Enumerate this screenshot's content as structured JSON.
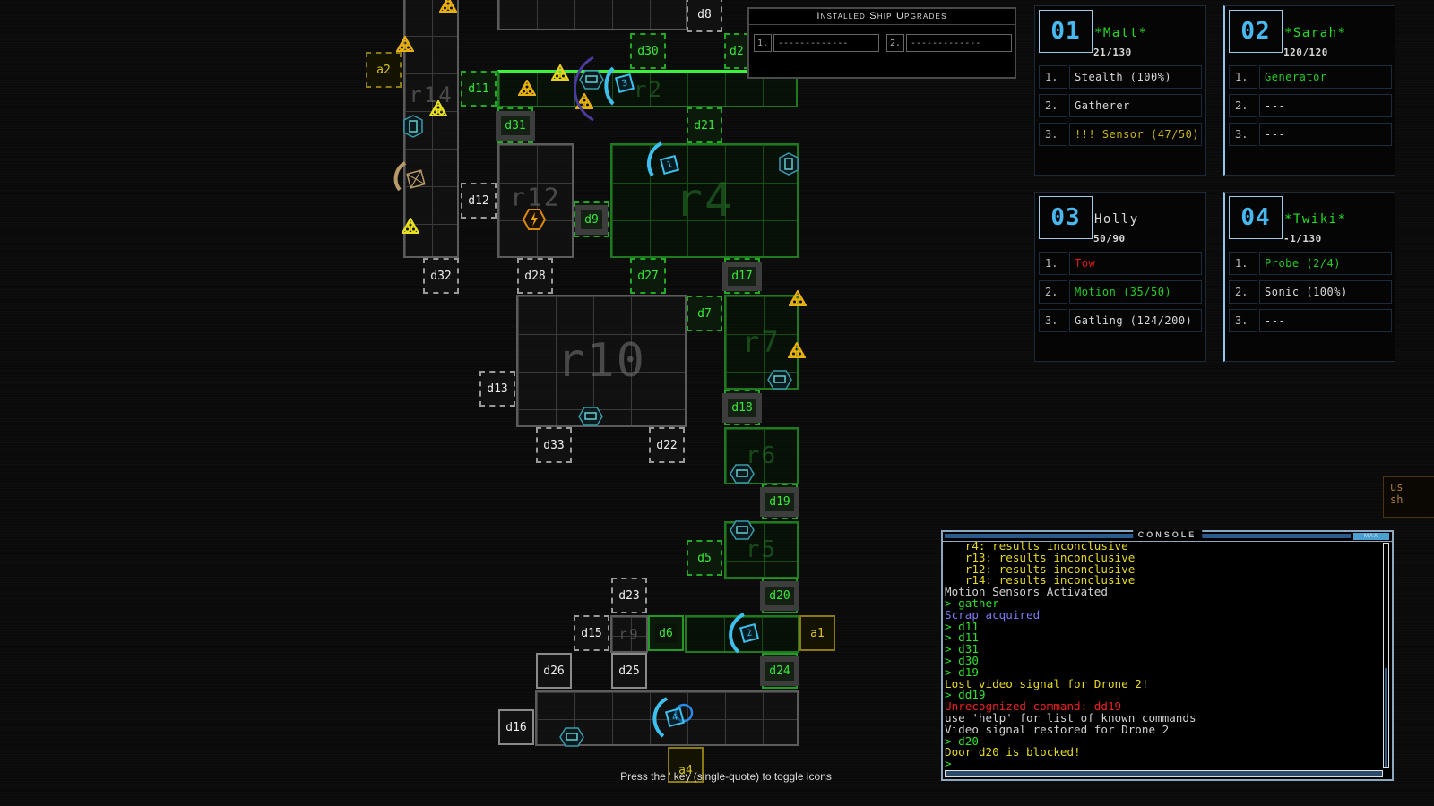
{
  "upgrades": {
    "title": "Installed Ship Upgrades",
    "slots": [
      {
        "num": "1.",
        "value": "-------------"
      },
      {
        "num": "2.",
        "value": "-------------"
      }
    ]
  },
  "drones": [
    {
      "id": "01",
      "name": "*Matt*",
      "name_color": "#22dd22",
      "hp": "21/130",
      "items": [
        {
          "num": "1.",
          "label": "Stealth (100%)",
          "color": "#d8d8d8"
        },
        {
          "num": "2.",
          "label": "Gatherer",
          "color": "#d8d8d8"
        },
        {
          "num": "3.",
          "label": "!!! Sensor (47/50)",
          "color": "#c8b412"
        }
      ]
    },
    {
      "id": "02",
      "name": "*Sarah*",
      "name_color": "#22dd22",
      "hp": "120/120",
      "items": [
        {
          "num": "1.",
          "label": "Generator",
          "color": "#22cc22"
        },
        {
          "num": "2.",
          "label": "---",
          "color": "#d8d8d8"
        },
        {
          "num": "3.",
          "label": "---",
          "color": "#d8d8d8"
        }
      ]
    },
    {
      "id": "03",
      "name": "Holly",
      "name_color": "#d8d8d8",
      "hp": "50/90",
      "items": [
        {
          "num": "1.",
          "label": "Tow",
          "color": "#dd1a1a"
        },
        {
          "num": "2.",
          "label": "Motion (35/50)",
          "color": "#22cc22"
        },
        {
          "num": "3.",
          "label": "Gatling (124/200)",
          "color": "#d8d8d8"
        }
      ]
    },
    {
      "id": "04",
      "name": "*Twiki*",
      "name_color": "#22dd22",
      "hp": "-1/130",
      "items": [
        {
          "num": "1.",
          "label": "Probe (2/4)",
          "color": "#22cc22"
        },
        {
          "num": "2.",
          "label": "Sonic (100%)",
          "color": "#d8d8d8"
        },
        {
          "num": "3.",
          "label": "---",
          "color": "#d8d8d8"
        }
      ]
    }
  ],
  "console": {
    "title": "CONSOLE",
    "max_label": "MAX",
    "lines": [
      {
        "text": "   r4: results inconclusive",
        "color": "yellow"
      },
      {
        "text": "   r13: results inconclusive",
        "color": "yellow"
      },
      {
        "text": "   r12: results inconclusive",
        "color": "yellow"
      },
      {
        "text": "   r14: results inconclusive",
        "color": "yellow"
      },
      {
        "text": "Motion Sensors Activated",
        "color": "white"
      },
      {
        "text": "> gather",
        "color": "green"
      },
      {
        "text": "Scrap acquired",
        "color": "blue"
      },
      {
        "text": "> d11",
        "color": "green"
      },
      {
        "text": "> d11",
        "color": "green"
      },
      {
        "text": "> d31",
        "color": "green"
      },
      {
        "text": "> d30",
        "color": "green"
      },
      {
        "text": "> d19",
        "color": "green"
      },
      {
        "text": "Lost video signal for Drone 2!",
        "color": "yellow"
      },
      {
        "text": "> dd19",
        "color": "green"
      },
      {
        "text": "Unrecognized command: dd19",
        "color": "red"
      },
      {
        "text": "use 'help' for list of known commands",
        "color": "white"
      },
      {
        "text": "Video signal restored for Drone 2",
        "color": "white"
      },
      {
        "text": "> d20",
        "color": "green"
      },
      {
        "text": "Door d20 is blocked!",
        "color": "yellow"
      },
      {
        "text": ">",
        "color": "green"
      }
    ],
    "input_value": ""
  },
  "side_tip": {
    "line1": "us",
    "line2": "sh"
  },
  "hint": "Press the ' key (single-quote) to toggle icons",
  "map": {
    "rooms": [
      {
        "id": "r14",
        "label": "r14",
        "style": "gray"
      },
      {
        "id": "r12",
        "label": "r12",
        "style": "gray"
      },
      {
        "id": "r2",
        "label": "r2",
        "style": "green"
      },
      {
        "id": "r4",
        "label": "r4",
        "style": "green"
      },
      {
        "id": "r10",
        "label": "r10",
        "style": "gray"
      },
      {
        "id": "r7",
        "label": "r7",
        "style": "green"
      },
      {
        "id": "r6",
        "label": "r6",
        "style": "green"
      },
      {
        "id": "r5",
        "label": "r5",
        "style": "green"
      },
      {
        "id": "r9",
        "label": "r9",
        "style": "gray"
      },
      {
        "id": "r3",
        "label": "",
        "style": "green"
      },
      {
        "id": "r1",
        "label": "",
        "style": "gray"
      }
    ],
    "doors": [
      "d8",
      "d30",
      "d2",
      "d11",
      "d31",
      "d21",
      "d12",
      "d9",
      "d32",
      "d28",
      "d27",
      "d17",
      "d7",
      "d13",
      "d18",
      "d33",
      "d22",
      "d19",
      "d5",
      "d23",
      "d20",
      "d15",
      "d6",
      "d26",
      "d25",
      "d24",
      "d16"
    ],
    "airlocks": [
      "a2",
      "a1",
      "a4"
    ],
    "drones_on_map": [
      "1",
      "2",
      "3",
      "4"
    ]
  }
}
